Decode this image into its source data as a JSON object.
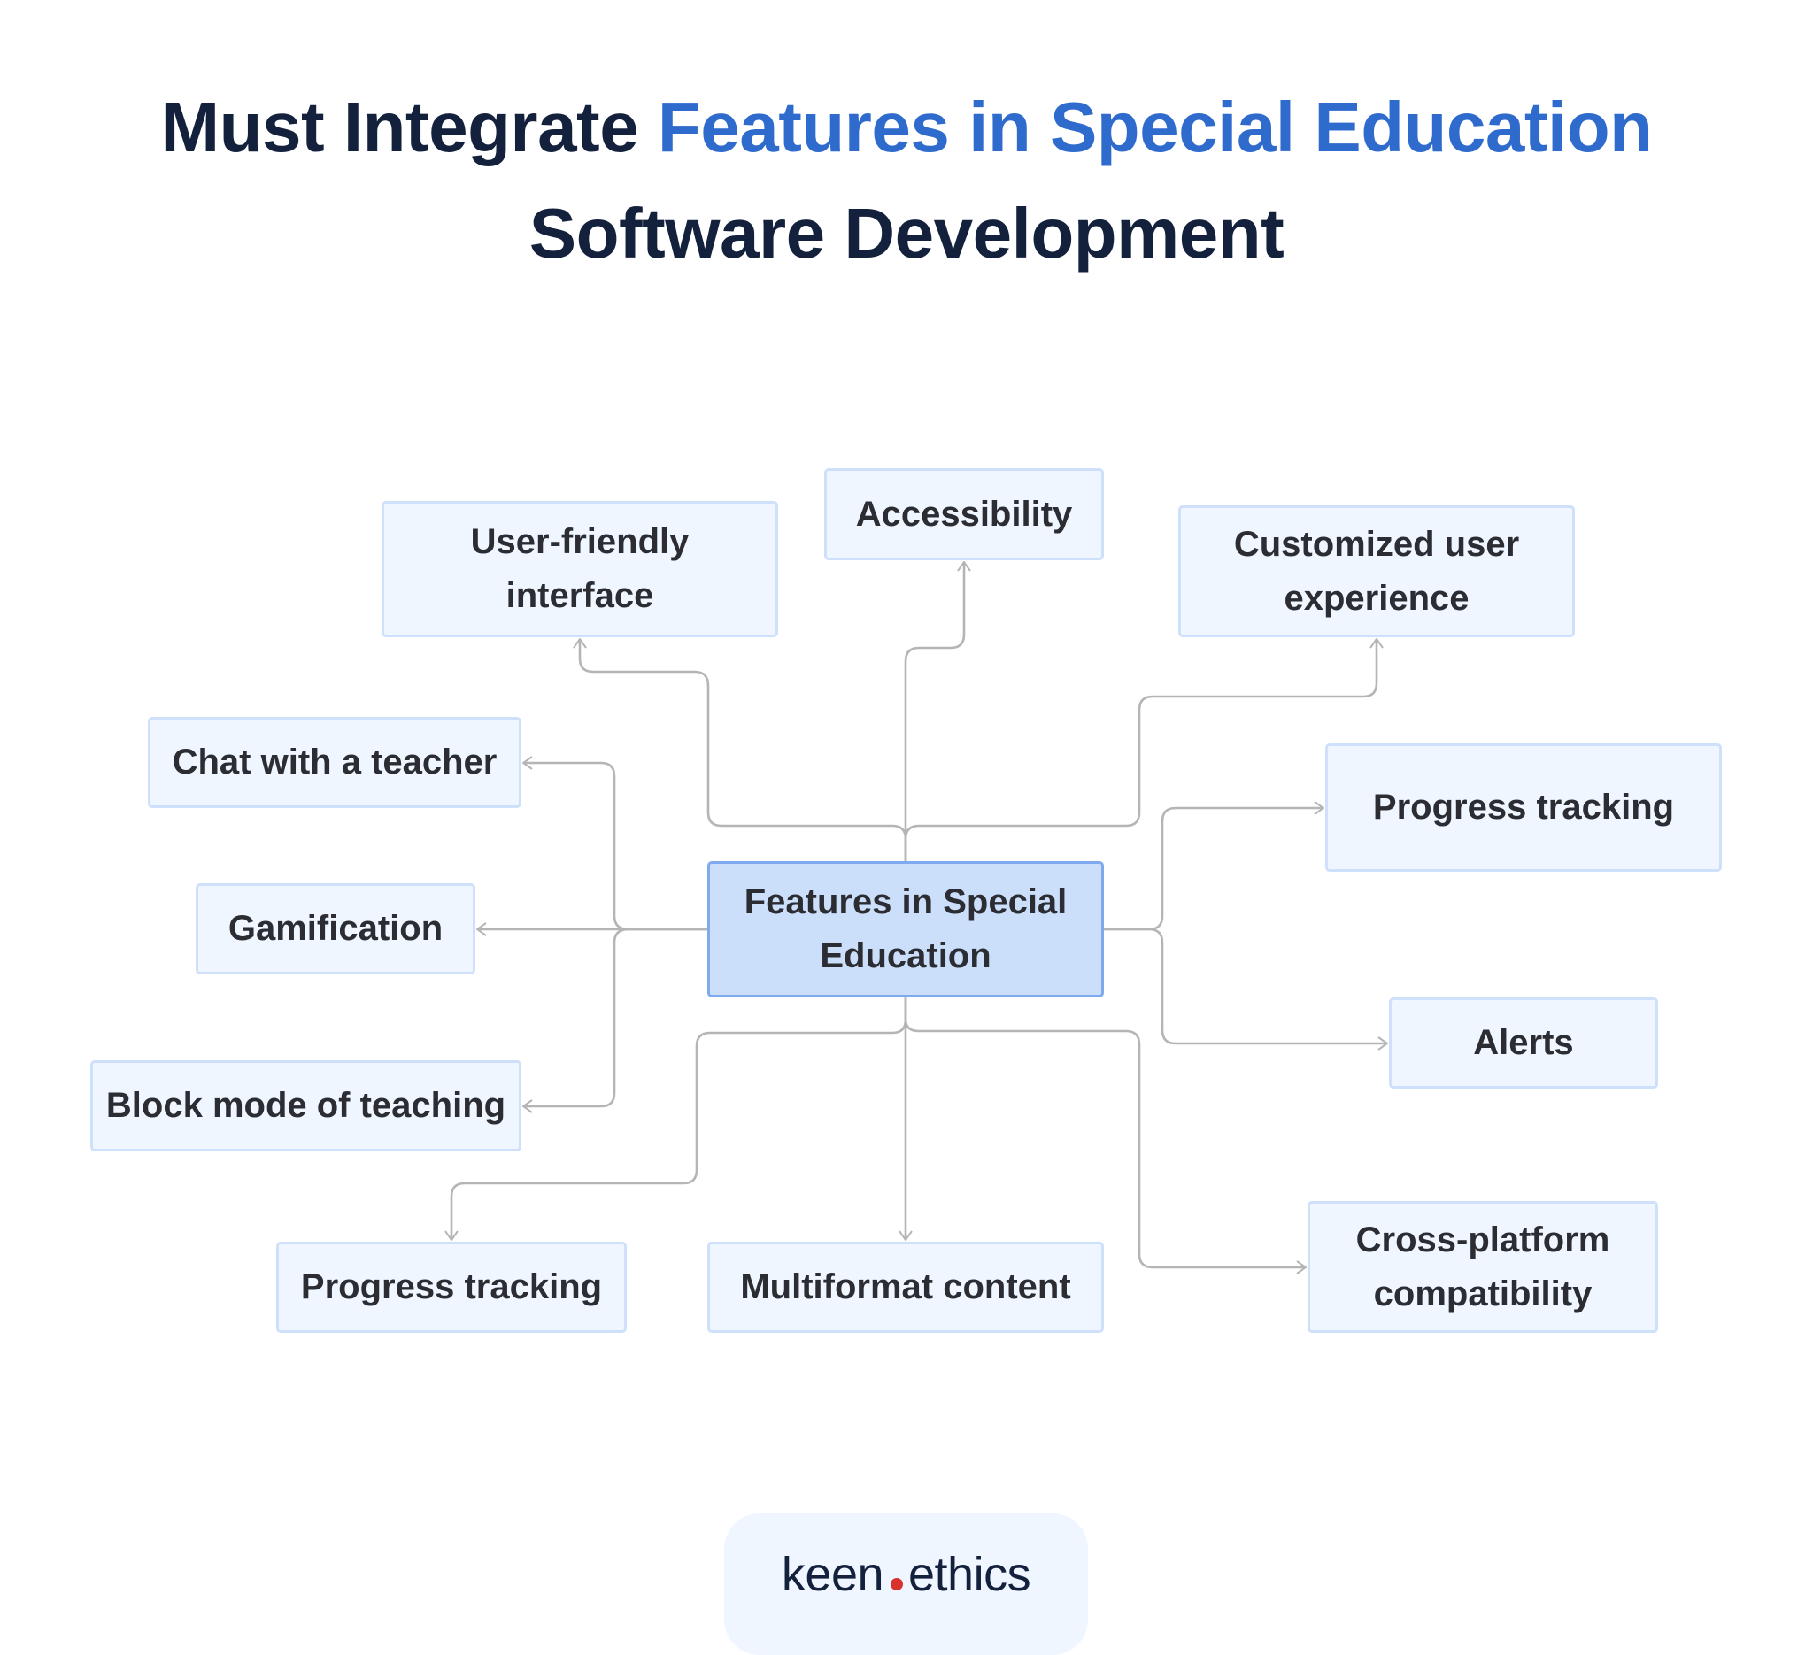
{
  "title": {
    "line1_prefix": "Must Integrate ",
    "line1_accent": "Features in Special Education",
    "line2": "Software Development"
  },
  "colors": {
    "title_dark": "#14213d",
    "title_accent": "#2f6bcc",
    "node_fill": "#eff6ff",
    "node_border": "#cfe0fb",
    "center_fill": "#cbdffb",
    "center_border": "#7faaf0",
    "connector": "#b5b5b5",
    "logo_dot": "#d8322d"
  },
  "diagram": {
    "center": {
      "label": "Features in Special Education"
    },
    "nodes": [
      {
        "id": "user-friendly-interface",
        "label": "User-friendly interface"
      },
      {
        "id": "accessibility",
        "label": "Accessibility"
      },
      {
        "id": "customized-user-experience",
        "label": "Customized user experience"
      },
      {
        "id": "chat-with-a-teacher",
        "label": "Chat with a teacher"
      },
      {
        "id": "progress-tracking-right",
        "label": "Progress tracking"
      },
      {
        "id": "gamification",
        "label": "Gamification"
      },
      {
        "id": "alerts",
        "label": "Alerts"
      },
      {
        "id": "block-mode-of-teaching",
        "label": "Block mode of teaching"
      },
      {
        "id": "progress-tracking-bottom",
        "label": "Progress tracking"
      },
      {
        "id": "multiformat-content",
        "label": "Multiformat content"
      },
      {
        "id": "cross-platform-compatibility",
        "label": "Cross-platform compatibility"
      }
    ],
    "edges": [
      {
        "from": "center",
        "to": "user-friendly-interface"
      },
      {
        "from": "center",
        "to": "accessibility"
      },
      {
        "from": "center",
        "to": "customized-user-experience"
      },
      {
        "from": "center",
        "to": "chat-with-a-teacher"
      },
      {
        "from": "center",
        "to": "progress-tracking-right"
      },
      {
        "from": "center",
        "to": "gamification"
      },
      {
        "from": "center",
        "to": "alerts"
      },
      {
        "from": "center",
        "to": "block-mode-of-teaching"
      },
      {
        "from": "center",
        "to": "progress-tracking-bottom"
      },
      {
        "from": "center",
        "to": "multiformat-content"
      },
      {
        "from": "center",
        "to": "cross-platform-compatibility"
      }
    ]
  },
  "footer": {
    "logo_left": "keen",
    "logo_right": "ethics"
  }
}
